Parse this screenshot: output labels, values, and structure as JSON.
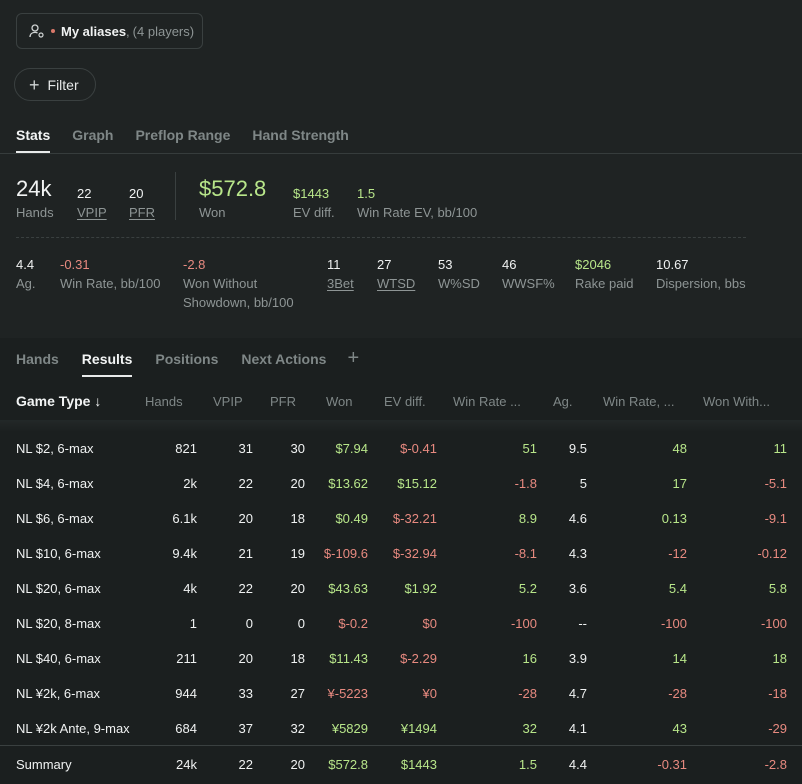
{
  "player_selector": {
    "label": "My aliases",
    "count": "(4 players)"
  },
  "filter": {
    "label": "Filter"
  },
  "stats_tabs": [
    "Stats",
    "Graph",
    "Preflop Range",
    "Hand Strength"
  ],
  "summary": {
    "hands": {
      "value": "24k",
      "label": "Hands"
    },
    "vpip": {
      "value": "22",
      "label": "VPIP"
    },
    "pfr": {
      "value": "20",
      "label": "PFR"
    },
    "won": {
      "value": "$572.8",
      "label": "Won"
    },
    "ev_diff": {
      "value": "$1443",
      "label": "EV diff."
    },
    "win_rate_ev": {
      "value": "1.5",
      "label": "Win Rate EV, bb/100"
    }
  },
  "secondary": {
    "ag": {
      "value": "4.4",
      "label": "Ag."
    },
    "win_rate": {
      "value": "-0.31",
      "label": "Win Rate, bb/100"
    },
    "wwsd": {
      "value": "-2.8",
      "label1": "Won Without",
      "label2": "Showdown, bb/100"
    },
    "threebet": {
      "value": "11",
      "label": "3Bet"
    },
    "wtsd": {
      "value": "27",
      "label": "WTSD"
    },
    "wsd": {
      "value": "53",
      "label": "W%SD"
    },
    "wwsf": {
      "value": "46",
      "label": "WWSF%"
    },
    "rake": {
      "value": "$2046",
      "label": "Rake paid"
    },
    "dispersion": {
      "value": "10.67",
      "label": "Dispersion, bbs"
    }
  },
  "results_tabs": [
    "Hands",
    "Results",
    "Positions",
    "Next Actions"
  ],
  "table": {
    "headers": [
      "Game Type ↓",
      "Hands",
      "VPIP",
      "PFR",
      "Won",
      "EV diff.",
      "Win Rate ...",
      "Ag.",
      "Win Rate, ...",
      "Won With..."
    ],
    "rows": [
      [
        "NL $2, 6-max",
        "821",
        "31",
        "30",
        "$7.94",
        "$-0.41",
        "51",
        "9.5",
        "48",
        "11"
      ],
      [
        "NL $4, 6-max",
        "2k",
        "22",
        "20",
        "$13.62",
        "$15.12",
        "-1.8",
        "5",
        "17",
        "-5.1"
      ],
      [
        "NL $6, 6-max",
        "6.1k",
        "20",
        "18",
        "$0.49",
        "$-32.21",
        "8.9",
        "4.6",
        "0.13",
        "-9.1"
      ],
      [
        "NL $10, 6-max",
        "9.4k",
        "21",
        "19",
        "$-109.6",
        "$-32.94",
        "-8.1",
        "4.3",
        "-12",
        "-0.12"
      ],
      [
        "NL $20, 6-max",
        "4k",
        "22",
        "20",
        "$43.63",
        "$1.92",
        "5.2",
        "3.6",
        "5.4",
        "5.8"
      ],
      [
        "NL $20, 8-max",
        "1",
        "0",
        "0",
        "$-0.2",
        "$0",
        "-100",
        "--",
        "-100",
        "-100"
      ],
      [
        "NL $40, 6-max",
        "211",
        "20",
        "18",
        "$11.43",
        "$-2.29",
        "16",
        "3.9",
        "14",
        "18"
      ],
      [
        "NL ¥2k, 6-max",
        "944",
        "33",
        "27",
        "¥-5223",
        "¥0",
        "-28",
        "4.7",
        "-28",
        "-18"
      ],
      [
        "NL ¥2k Ante, 9-max",
        "684",
        "37",
        "32",
        "¥5829",
        "¥1494",
        "32",
        "4.1",
        "43",
        "-29"
      ]
    ],
    "summary_row": [
      "Summary",
      "24k",
      "22",
      "20",
      "$572.8",
      "$1443",
      "1.5",
      "4.4",
      "-0.31",
      "-2.8"
    ]
  },
  "colors": {
    "positive": "#b8e68a",
    "negative": "#e88a80",
    "accent_dot": "#d9786a"
  }
}
